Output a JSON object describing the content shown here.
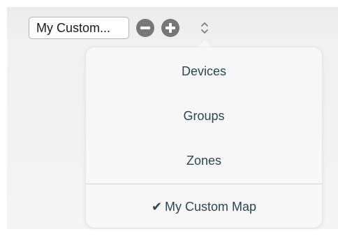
{
  "toolbar": {
    "map_select_value": "My Custom...",
    "remove_button_icon": "minus-circle-icon",
    "add_button_icon": "plus-circle-icon",
    "sort_icon": "up-down-chevron-icon"
  },
  "menu": {
    "items": [
      {
        "label": "Devices",
        "selected": false
      },
      {
        "label": "Groups",
        "selected": false
      },
      {
        "label": "Zones",
        "selected": false
      },
      {
        "label": "My Custom Map",
        "selected": true
      }
    ],
    "check_glyph": "✔",
    "text_color": "#2e4653"
  }
}
